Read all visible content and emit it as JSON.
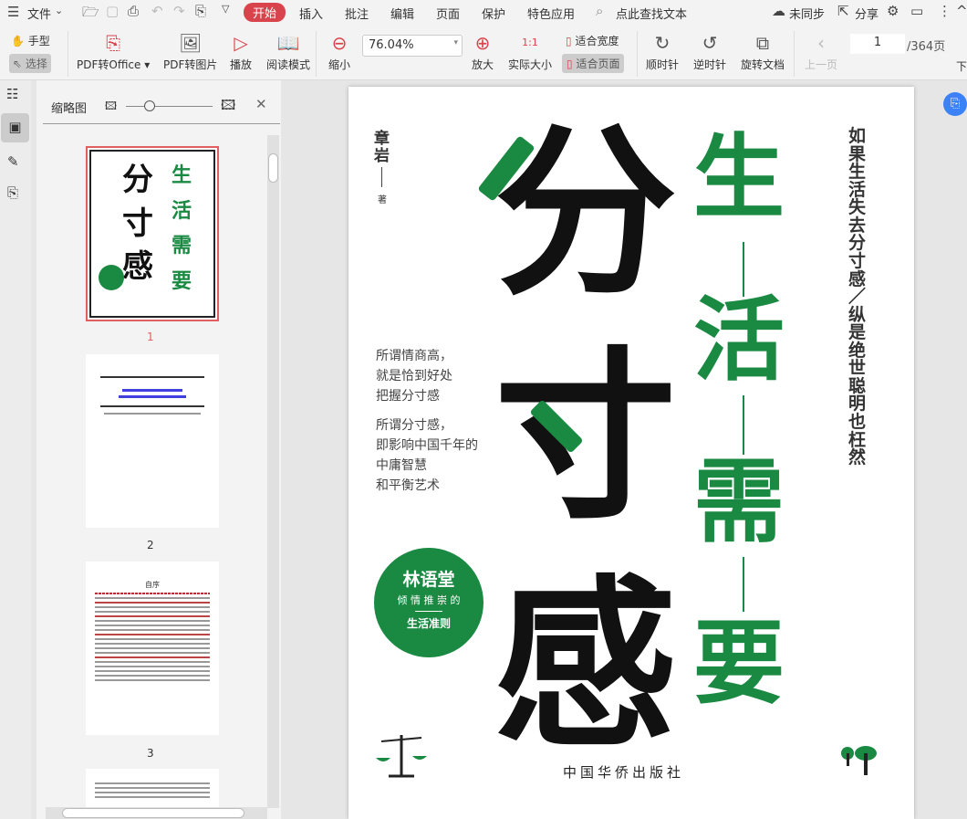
{
  "menubar": {
    "file": "文件",
    "tabs": [
      "开始",
      "插入",
      "批注",
      "编辑",
      "页面",
      "保护",
      "特色应用"
    ],
    "search_placeholder": "点此查找文本",
    "sync": "未同步",
    "share": "分享"
  },
  "toolbar": {
    "hand": "手型",
    "select": "选择",
    "pdf_to_office": "PDF转Office",
    "pdf_to_image": "PDF转图片",
    "play": "播放",
    "read_mode": "阅读模式",
    "zoom_out": "缩小",
    "zoom_value": "76.04%",
    "zoom_in": "放大",
    "actual_size": "实际大小",
    "actual_icon": "1:1",
    "fit_width": "适合宽度",
    "fit_page": "适合页面",
    "clockwise": "顺时针",
    "counterclockwise": "逆时针",
    "rotate_doc": "旋转文档",
    "prev_page": "上一页",
    "next_page": "下",
    "page_current": "1",
    "page_total": "/364页"
  },
  "thumbnails": {
    "title": "缩略图",
    "pages": [
      "1",
      "2",
      "3"
    ],
    "page3_heading": "自序"
  },
  "cover": {
    "author": "章岩",
    "author_suffix": "著",
    "big_chars": [
      "分",
      "寸",
      "感"
    ],
    "green_chars": [
      "生",
      "活",
      "需",
      "要"
    ],
    "side_text": "如果生活失去分寸感／纵是绝世聪明也枉然",
    "blurb1": [
      "所谓情商高，",
      "就是恰到好处",
      "把握分寸感"
    ],
    "blurb2": [
      "所谓分寸感，",
      "即影响中国千年的",
      "中庸智慧",
      "和平衡艺术"
    ],
    "badge": {
      "name": "林语堂",
      "line": "倾 情 推 崇 的",
      "rule": "生活准则"
    },
    "publisher": "中国华侨出版社"
  },
  "colors": {
    "accent": "#d9434c",
    "green": "#1a8a43"
  }
}
